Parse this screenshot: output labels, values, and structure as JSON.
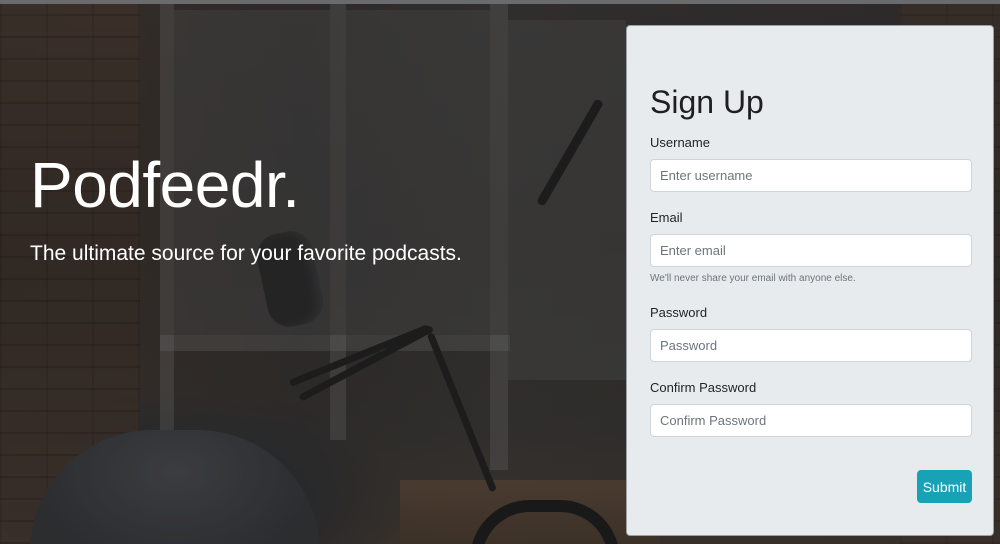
{
  "hero": {
    "brand": "Podfeedr.",
    "tagline": "The ultimate source for your favorite podcasts."
  },
  "signup": {
    "title": "Sign Up",
    "username": {
      "label": "Username",
      "placeholder": "Enter username",
      "value": ""
    },
    "email": {
      "label": "Email",
      "placeholder": "Enter email",
      "value": "",
      "help": "We'll never share your email with anyone else."
    },
    "password": {
      "label": "Password",
      "placeholder": "Password",
      "value": ""
    },
    "confirm_password": {
      "label": "Confirm Password",
      "placeholder": "Confirm Password",
      "value": ""
    },
    "submit_label": "Submit"
  },
  "colors": {
    "accent": "#17a2b8",
    "card_background": "#e8ebee",
    "hero_text": "#ffffff"
  }
}
